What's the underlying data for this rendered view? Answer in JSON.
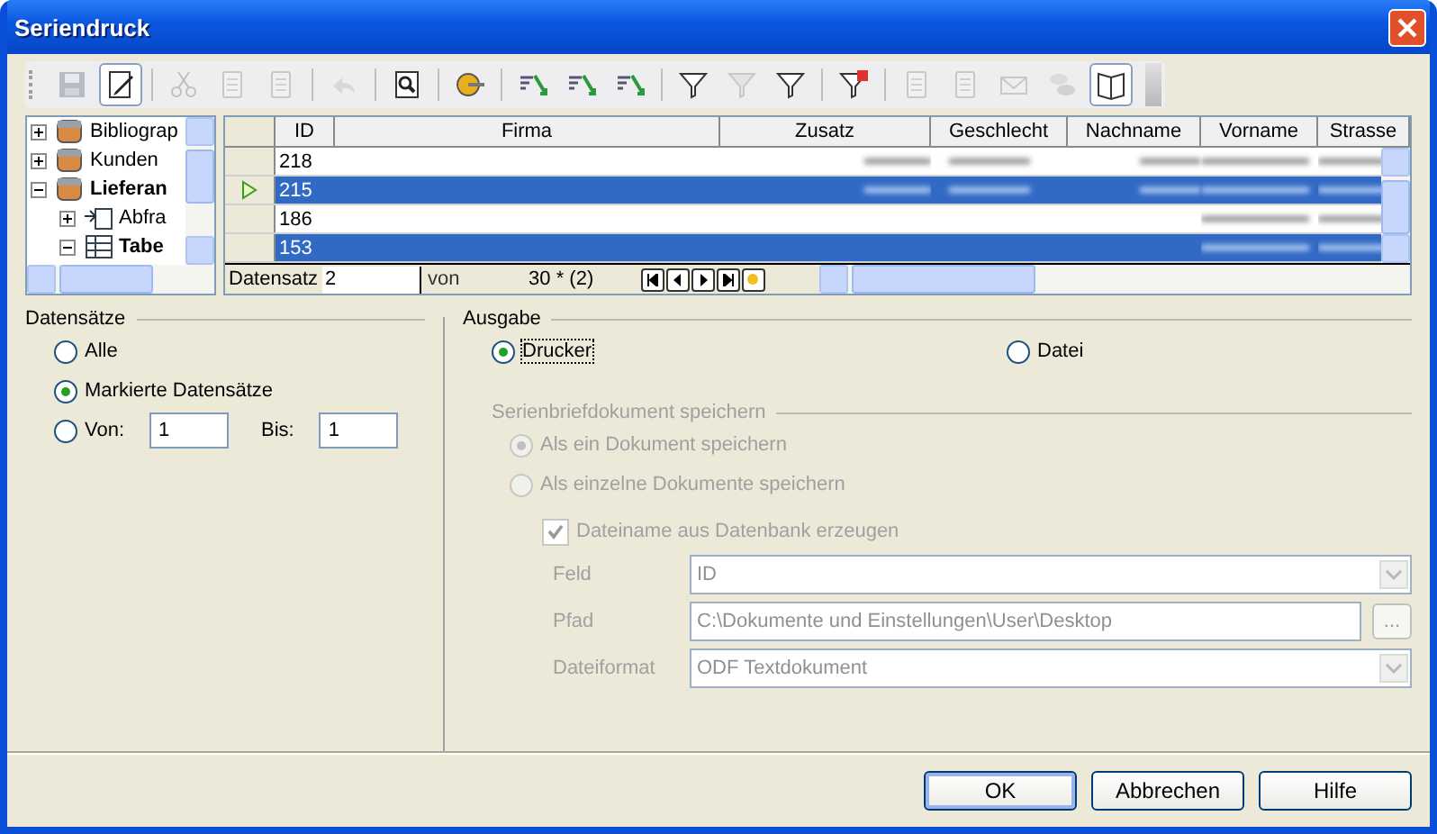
{
  "window": {
    "title": "Seriendruck"
  },
  "toolbar": [
    {
      "kind": "save",
      "disabled": true,
      "pressed": false
    },
    {
      "kind": "edit",
      "disabled": false,
      "pressed": true
    },
    {
      "kind": "sep"
    },
    {
      "kind": "cut",
      "disabled": true,
      "pressed": false
    },
    {
      "kind": "copy",
      "disabled": true,
      "pressed": false
    },
    {
      "kind": "paste",
      "disabled": true,
      "pressed": false
    },
    {
      "kind": "sep"
    },
    {
      "kind": "undo",
      "disabled": true,
      "pressed": false
    },
    {
      "kind": "sep"
    },
    {
      "kind": "find",
      "disabled": false,
      "pressed": false
    },
    {
      "kind": "sep"
    },
    {
      "kind": "wizard",
      "disabled": false,
      "pressed": false
    },
    {
      "kind": "sep"
    },
    {
      "kind": "sort",
      "disabled": false,
      "pressed": false
    },
    {
      "kind": "sortasc",
      "disabled": false,
      "pressed": false
    },
    {
      "kind": "sortdesc",
      "disabled": false,
      "pressed": false
    },
    {
      "kind": "sep"
    },
    {
      "kind": "filter",
      "disabled": false,
      "pressed": false
    },
    {
      "kind": "filter",
      "disabled": true,
      "pressed": false
    },
    {
      "kind": "filter",
      "disabled": false,
      "pressed": false
    },
    {
      "kind": "sep"
    },
    {
      "kind": "removefilter",
      "disabled": false,
      "pressed": false
    },
    {
      "kind": "sep"
    },
    {
      "kind": "page",
      "disabled": true,
      "pressed": false
    },
    {
      "kind": "page",
      "disabled": true,
      "pressed": false
    },
    {
      "kind": "mail",
      "disabled": true,
      "pressed": false
    },
    {
      "kind": "db",
      "disabled": true,
      "pressed": false
    },
    {
      "kind": "book",
      "disabled": false,
      "pressed": true
    }
  ],
  "tree": [
    {
      "label": "Bibliograp",
      "bold": false,
      "expanded": false,
      "kind": "db"
    },
    {
      "label": "Kunden",
      "bold": false,
      "expanded": false,
      "kind": "db"
    },
    {
      "label": "Lieferan",
      "bold": true,
      "expanded": true,
      "kind": "db",
      "children": [
        {
          "label": "Abfra",
          "bold": false,
          "expanded": false,
          "kind": "query"
        },
        {
          "label": "Tabe",
          "bold": true,
          "expanded": true,
          "kind": "table"
        }
      ]
    }
  ],
  "grid": {
    "columns": [
      "ID",
      "Firma",
      "Zusatz",
      "Geschlecht",
      "Nachname",
      "Vorname",
      "Strasse"
    ],
    "rows": [
      {
        "id": "218",
        "selected": false,
        "current": false
      },
      {
        "id": "215",
        "selected": true,
        "current": true
      },
      {
        "id": "186",
        "selected": false,
        "current": false
      },
      {
        "id": "153",
        "selected": true,
        "current": false
      }
    ]
  },
  "navigator": {
    "label": "Datensatz",
    "value": "2",
    "of_label": "von",
    "count": "30 * (2)"
  },
  "records": {
    "title": "Datensätze",
    "options": [
      {
        "label": "Alle",
        "selected": false
      },
      {
        "label": "Markierte Datensätze",
        "selected": true
      },
      {
        "label": "Von:",
        "selected": false
      }
    ],
    "from": "1",
    "to_label": "Bis:",
    "to": "1"
  },
  "output": {
    "title": "Ausgabe",
    "options": [
      {
        "label": "Drucker",
        "selected": true
      },
      {
        "label": "Datei",
        "selected": false
      }
    ]
  },
  "save": {
    "title": "Serienbriefdokument speichern",
    "disabled": true,
    "options": [
      {
        "label": "Als ein Dokument speichern",
        "selected": true
      },
      {
        "label": "Als einzelne Dokumente speichern",
        "selected": false
      }
    ],
    "filename_from_db": {
      "label": "Dateiname aus Datenbank erzeugen",
      "checked": true
    },
    "fields": [
      {
        "kind": "combo",
        "label": "Feld",
        "value": "ID"
      },
      {
        "kind": "path",
        "label": "Pfad",
        "value": "C:\\Dokumente und Einstellungen\\User\\Desktop",
        "button": "..."
      },
      {
        "kind": "combo",
        "label": "Dateiformat",
        "value": "ODF Textdokument"
      }
    ]
  },
  "buttons": [
    {
      "label": "OK",
      "default": true
    },
    {
      "label": "Abbrechen",
      "default": false
    },
    {
      "label": "Hilfe",
      "default": false
    }
  ]
}
